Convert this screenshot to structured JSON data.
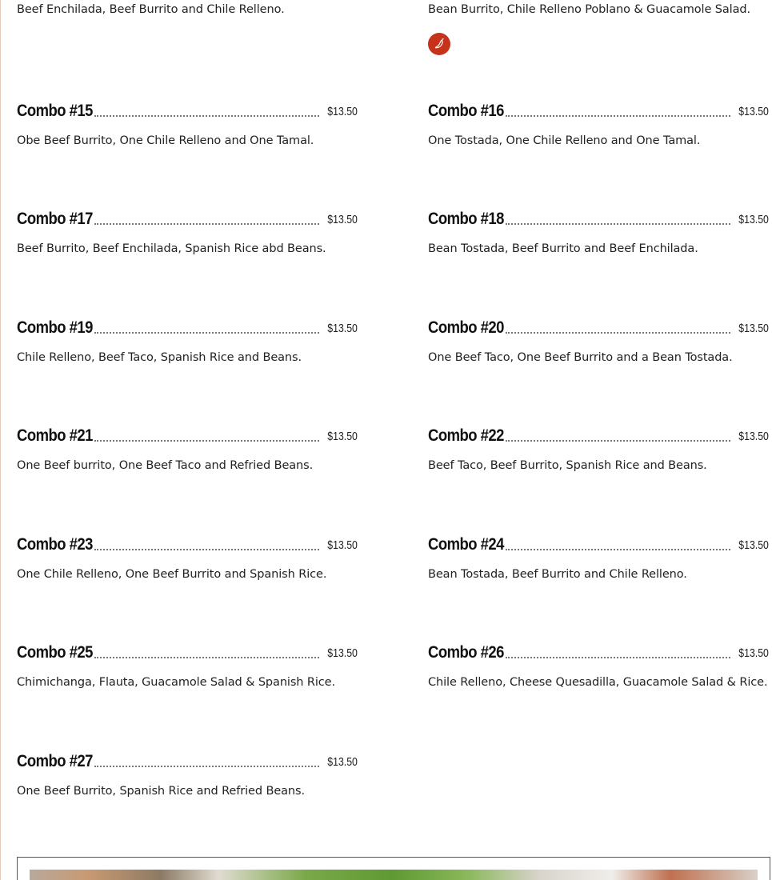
{
  "top_row": {
    "left_desc": "Beef Enchilada, Beef Burrito and Chile Relleno.",
    "right_desc": "Bean Burrito, Chile Relleno Poblano & Guacamole Salad.",
    "right_icon": "chili-pepper-icon",
    "icon_color": "#c7321a"
  },
  "combos": [
    {
      "name": "Combo #15",
      "price": "$13.50",
      "desc": "Obe Beef Burrito, One Chile Relleno and One Tamal."
    },
    {
      "name": "Combo #16",
      "price": "$13.50",
      "desc": "One Tostada, One Chile Relleno and One Tamal."
    },
    {
      "name": "Combo #17",
      "price": "$13.50",
      "desc": "Beef Burrito, Beef Enchilada, Spanish Rice abd Beans."
    },
    {
      "name": "Combo #18",
      "price": "$13.50",
      "desc": "Bean Tostada, Beef Burrito and Beef Enchilada."
    },
    {
      "name": "Combo #19",
      "price": "$13.50",
      "desc": "Chile Relleno, Beef Taco, Spanish Rice and Beans."
    },
    {
      "name": "Combo #20",
      "price": "$13.50",
      "desc": "One Beef Taco, One Beef Burrito and a Bean Tostada."
    },
    {
      "name": "Combo #21",
      "price": "$13.50",
      "desc": "One Beef burrito, One Beef Taco and Refried Beans."
    },
    {
      "name": "Combo #22",
      "price": "$13.50",
      "desc": "Beef Taco, Beef Burrito, Spanish Rice and Beans."
    },
    {
      "name": "Combo #23",
      "price": "$13.50",
      "desc": "One Chile Relleno, One Beef Burrito and Spanish Rice."
    },
    {
      "name": "Combo #24",
      "price": "$13.50",
      "desc": "Bean Tostada, Beef Burrito and Chile Relleno."
    },
    {
      "name": "Combo #25",
      "price": "$13.50",
      "desc": "Chimichanga, Flauta, Guacamole Salad & Spanish Rice."
    },
    {
      "name": "Combo #26",
      "price": "$13.50",
      "desc": "Chile Relleno, Cheese Quesadilla, Guacamole Salad & Rice."
    },
    {
      "name": "Combo #27",
      "price": "$13.50",
      "desc": "One Beef Burrito, Spanish Rice and Refried Beans."
    }
  ]
}
